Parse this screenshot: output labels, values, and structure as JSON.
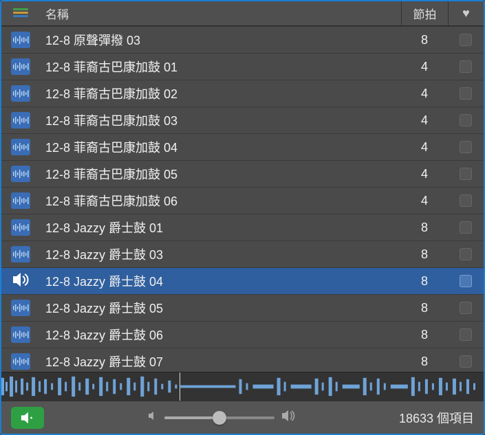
{
  "header": {
    "name_label": "名稱",
    "beats_label": "節拍"
  },
  "rows": [
    {
      "name": "12-8 原聲彈撥 03",
      "beats": "8",
      "selected": false,
      "playing": false
    },
    {
      "name": "12-8 菲裔古巴康加鼓 01",
      "beats": "4",
      "selected": false,
      "playing": false
    },
    {
      "name": "12-8 菲裔古巴康加鼓 02",
      "beats": "4",
      "selected": false,
      "playing": false
    },
    {
      "name": "12-8 菲裔古巴康加鼓 03",
      "beats": "4",
      "selected": false,
      "playing": false
    },
    {
      "name": "12-8 菲裔古巴康加鼓 04",
      "beats": "4",
      "selected": false,
      "playing": false
    },
    {
      "name": "12-8 菲裔古巴康加鼓 05",
      "beats": "4",
      "selected": false,
      "playing": false
    },
    {
      "name": "12-8 菲裔古巴康加鼓 06",
      "beats": "4",
      "selected": false,
      "playing": false
    },
    {
      "name": "12-8 Jazzy 爵士鼓 01",
      "beats": "8",
      "selected": false,
      "playing": false
    },
    {
      "name": "12-8 Jazzy 爵士鼓 03",
      "beats": "8",
      "selected": false,
      "playing": false
    },
    {
      "name": "12-8 Jazzy 爵士鼓 04",
      "beats": "8",
      "selected": true,
      "playing": true
    },
    {
      "name": "12-8 Jazzy 爵士鼓 05",
      "beats": "8",
      "selected": false,
      "playing": false
    },
    {
      "name": "12-8 Jazzy 爵士鼓 06",
      "beats": "8",
      "selected": false,
      "playing": false
    },
    {
      "name": "12-8 Jazzy 爵士鼓 07",
      "beats": "8",
      "selected": false,
      "playing": false
    }
  ],
  "footer": {
    "item_count": "18633 個項目",
    "volume_percent": 50
  }
}
